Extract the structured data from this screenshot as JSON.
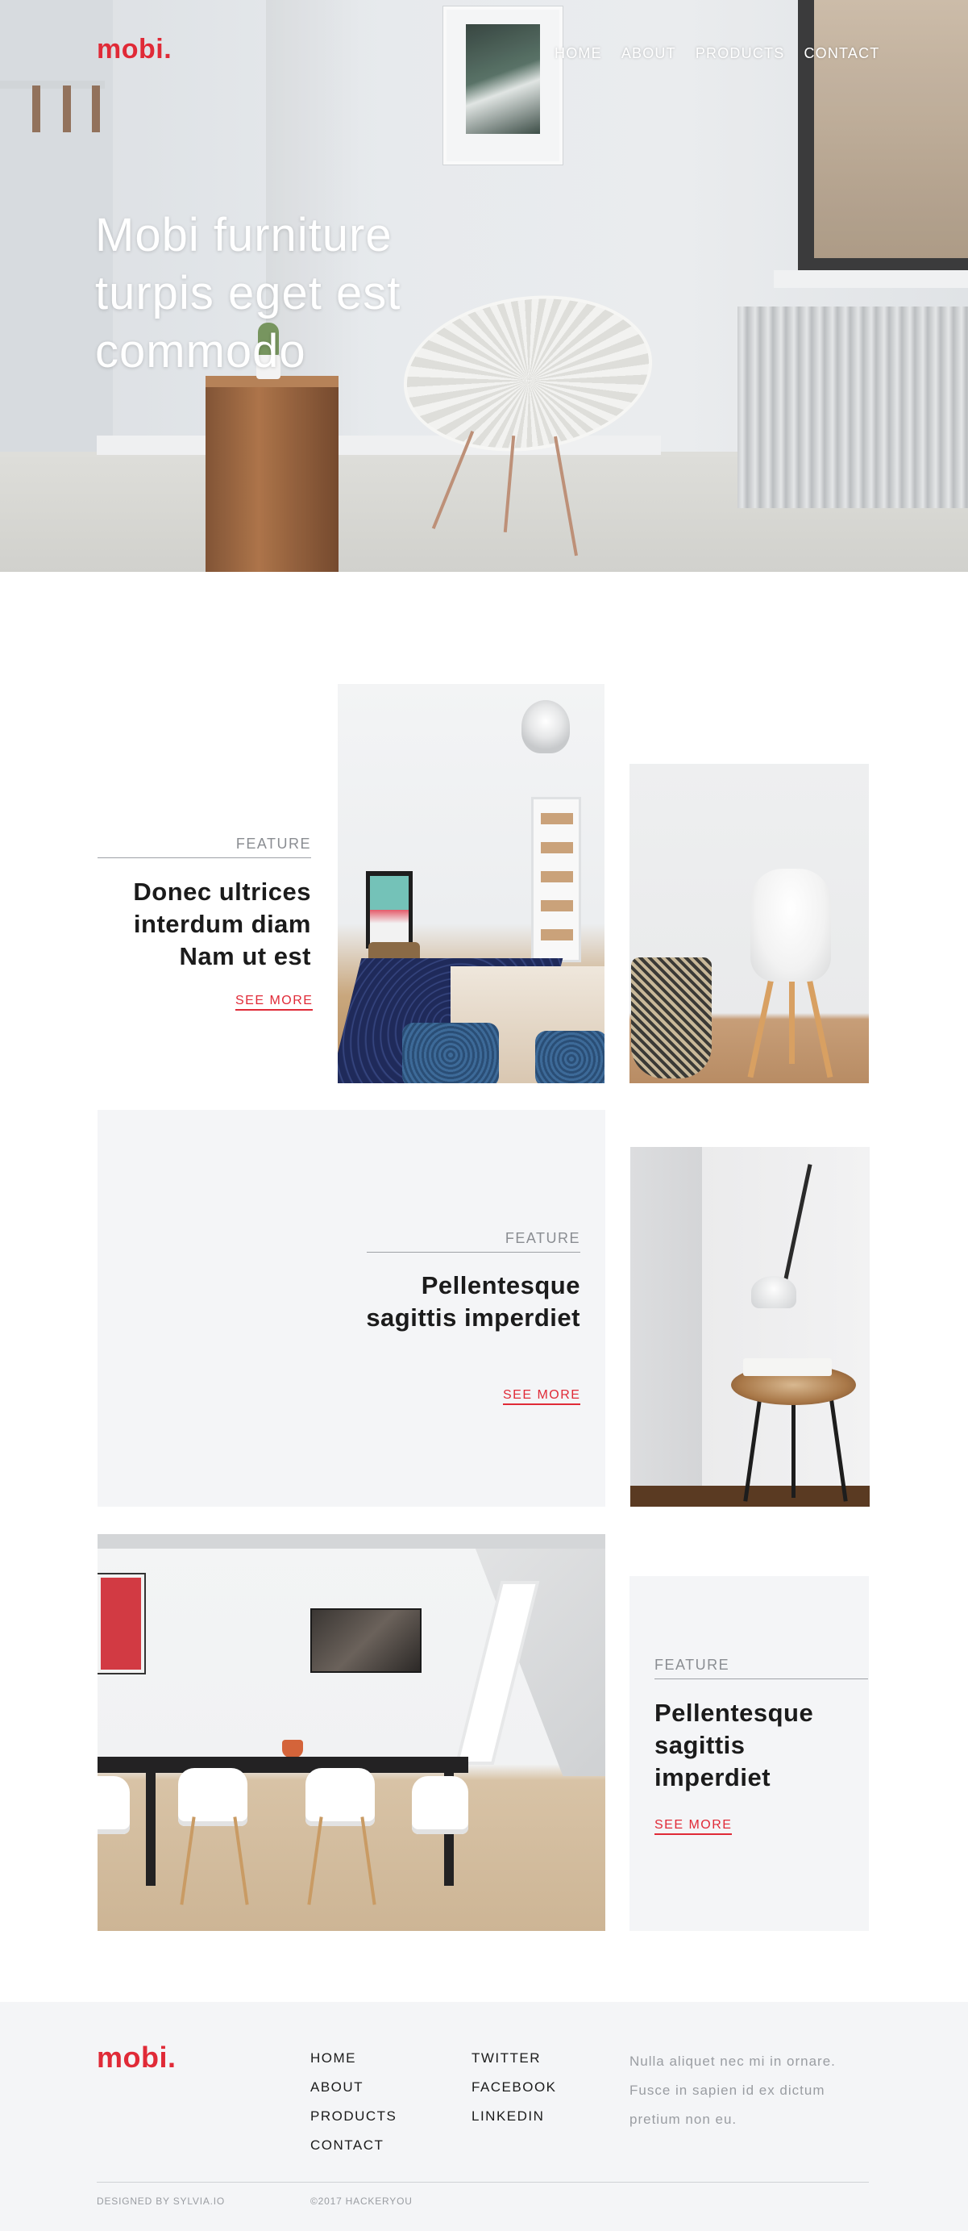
{
  "header": {
    "logo": "mobi.",
    "nav": [
      "HOME",
      "ABOUT",
      "PRODUCTS",
      "CONTACT"
    ]
  },
  "hero": {
    "title": "Mobi furniture turpis eget est commodo"
  },
  "features": [
    {
      "label": "FEATURE",
      "title": "Donec ultrices interdum diam Nam ut est",
      "link": "SEE MORE"
    },
    {
      "label": "FEATURE",
      "title": "Pellentesque sagittis imperdiet",
      "link": "SEE MORE"
    },
    {
      "label": "FEATURE",
      "title": "Pellentesque sagittis imperdiet",
      "link": "SEE MORE"
    }
  ],
  "footer": {
    "logo": "mobi.",
    "nav": [
      "HOME",
      "ABOUT",
      "PRODUCTS",
      "CONTACT"
    ],
    "social": [
      "TWITTER",
      "FACEBOOK",
      "LINKEDIN"
    ],
    "blurb": "Nulla aliquet nec mi in ornare. Fusce in sapien id ex dictum pretium non eu.",
    "credit": "DESIGNED BY SYLVIA.IO",
    "copyright": "©2017 HACKERYOU"
  },
  "colors": {
    "brand": "#e02a37",
    "card_background": "#f4f5f7",
    "text": "#1b1b1b",
    "muted": "#8a8d92"
  }
}
